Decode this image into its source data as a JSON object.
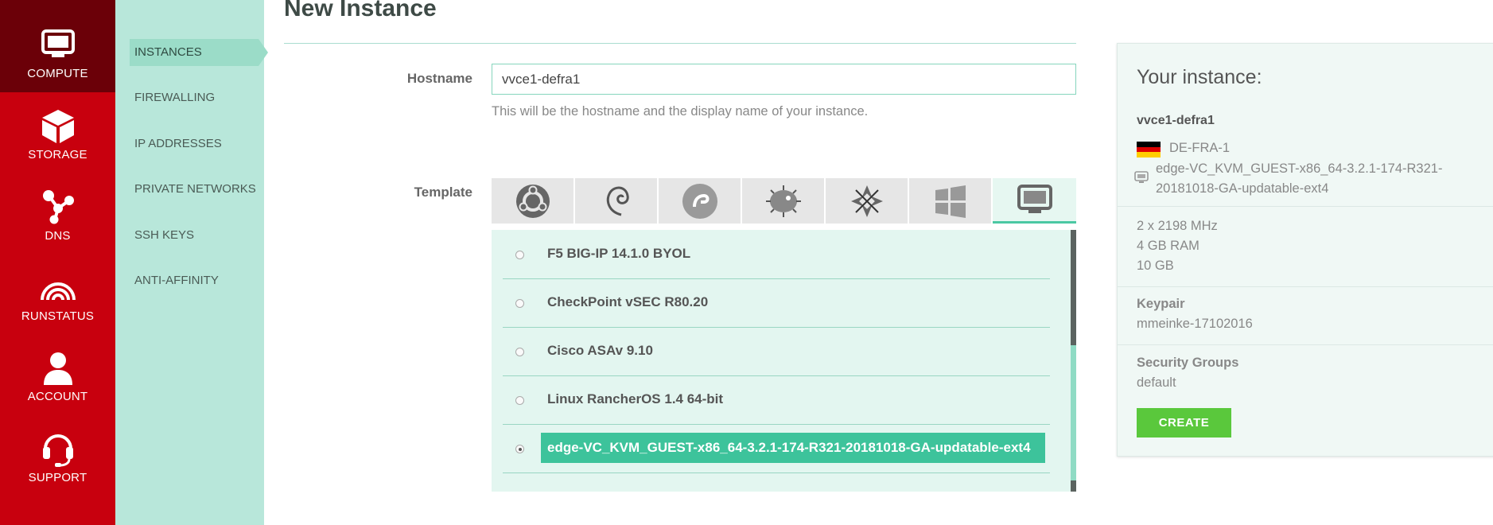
{
  "nav": {
    "items": [
      {
        "label": "COMPUTE",
        "icon": "monitor-icon"
      },
      {
        "label": "STORAGE",
        "icon": "cube-icon"
      },
      {
        "label": "DNS",
        "icon": "network-icon"
      },
      {
        "label": "RUNSTATUS",
        "icon": "signal-icon"
      },
      {
        "label": "ACCOUNT",
        "icon": "user-icon"
      },
      {
        "label": "SUPPORT",
        "icon": "headset-icon"
      }
    ],
    "active": "COMPUTE"
  },
  "subnav": {
    "items": [
      "INSTANCES",
      "FIREWALLING",
      "IP ADDRESSES",
      "PRIVATE NETWORKS",
      "SSH KEYS",
      "ANTI-AFFINITY"
    ],
    "active": "INSTANCES"
  },
  "page": {
    "title": "New Instance"
  },
  "form": {
    "hostname_label": "Hostname",
    "hostname_value": "vvce1-defra1",
    "hostname_help": "This will be the hostname and the display name of your instance.",
    "template_label": "Template",
    "os_tabs": [
      "ubuntu-icon",
      "debian-icon",
      "fedora-icon",
      "openbsd-icon",
      "centos-icon",
      "windows-icon",
      "custom-template-icon"
    ],
    "os_tab_active": "custom-template-icon",
    "templates": [
      {
        "name": "F5 BIG-IP 14.1.0 BYOL",
        "selected": false
      },
      {
        "name": "CheckPoint vSEC R80.20",
        "selected": false
      },
      {
        "name": "Cisco ASAv 9.10",
        "selected": false
      },
      {
        "name": "Linux RancherOS 1.4 64-bit",
        "selected": false
      },
      {
        "name": "edge-VC_KVM_GUEST-x86_64-3.2.1-174-R321-20181018-GA-updatable-ext4",
        "selected": true
      }
    ]
  },
  "summary": {
    "title": "Your instance:",
    "hostname": "vvce1-defra1",
    "zone": "DE-FRA-1",
    "template": "edge-VC_KVM_GUEST-x86_64-3.2.1-174-R321-20181018-GA-updatable-ext4",
    "cpu": "2 x 2198 MHz",
    "ram": "4 GB RAM",
    "disk": "10 GB",
    "keypair_label": "Keypair",
    "keypair": "mmeinke-17102016",
    "security_groups_label": "Security Groups",
    "security_groups": "default",
    "create_label": "CREATE"
  },
  "colors": {
    "nav_red": "#c8000e",
    "nav_active": "#6b0008",
    "subnav_bg": "#b8e7da",
    "accent_teal": "#3dc39b",
    "create_green": "#5ac83c"
  }
}
